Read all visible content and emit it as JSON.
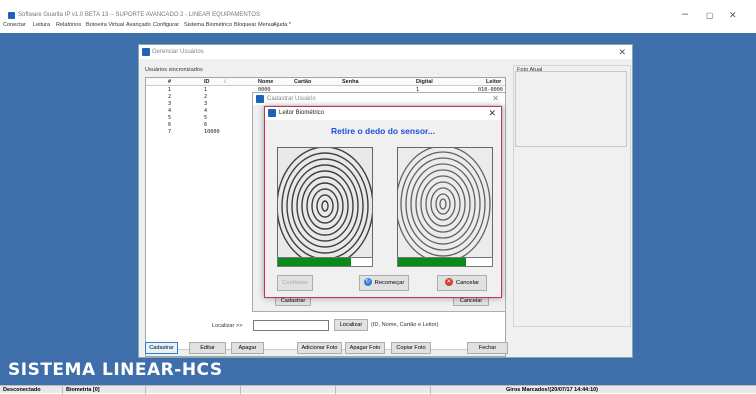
{
  "window": {
    "title": "Software Guarita IP v1.0 BETA 13 -- SUPORTE AVANCADO 2 - LINEAR EQUIPAMENTOS",
    "minimize": "–",
    "maximize": "▢",
    "close": "✕"
  },
  "menu": [
    "Conectar",
    "Leitura",
    "Relatórios",
    "Botoeira Virtual",
    "Avançado",
    "Configurar",
    "Sistema Biométrico",
    "Bloquear Menus",
    "Ajuda *"
  ],
  "footer_title": "SISTEMA LINEAR-HCS",
  "status": {
    "connection": "Desconectado",
    "biometria": "Biometria [0]",
    "giros": "Giros Marcados!(20/07/17 14:44:10)"
  },
  "gerenciar": {
    "title": "Gerenciar Usuários",
    "close": "✕",
    "group_label": "Usuários sincronizados",
    "foto_label": "Foto Atual",
    "columns": [
      "#",
      "ID",
      "Nome",
      "Cartão",
      "Senha",
      "Digital",
      "Leitor"
    ],
    "sort_glyph": "/.",
    "rows": [
      [
        "1",
        "1",
        "0000",
        "",
        "",
        "1",
        "010-0000"
      ],
      [
        "2",
        "2",
        "0000",
        "",
        "",
        "",
        ""
      ],
      [
        "3",
        "3",
        "0000",
        "",
        "",
        "",
        ""
      ],
      [
        "4",
        "4",
        "0000",
        "",
        "",
        "",
        ""
      ],
      [
        "5",
        "5",
        "0000",
        "",
        "",
        "",
        ""
      ],
      [
        "6",
        "6",
        "0000",
        "",
        "",
        "",
        ""
      ],
      [
        "7",
        "10000",
        "ADP",
        "",
        "",
        "",
        ""
      ]
    ],
    "scroll_left": "<",
    "localizar_label": "Localizar >>",
    "localizar_button": "Localizar",
    "localizar_hint": "(ID, Nome, Cartão e Leitor)",
    "buttons": {
      "cadastrar": "Cadastrar",
      "editar": "Editar",
      "apagar": "Apagar",
      "adicionar_foto": "Adicionar Foto",
      "apagar_foto": "Apagar Foto",
      "copiar_foto": "Copiar Foto",
      "fechar": "Fechar"
    }
  },
  "cadastrar_usuario": {
    "title": "Cadastrar Usuário",
    "close": "✕",
    "cadastrar": "Cadastrar",
    "cancelar": "Cancelar"
  },
  "leitor": {
    "title": "Leitor Biométrico",
    "close": "✕",
    "message": "Retire o dedo do sensor...",
    "progress_left": 0.78,
    "progress_right": 0.72,
    "progress_color": "#0a8a1a",
    "confirm_button": "Confirmar",
    "restart_button": "Recomeçar",
    "cancel_button": "Cancelar",
    "restart_icon": "refresh-icon",
    "cancel_icon": "cancel-icon"
  },
  "colors": {
    "desktop": "#3f6faa",
    "accent": "#1f4ed8",
    "dialog_border": "#c0335a"
  }
}
